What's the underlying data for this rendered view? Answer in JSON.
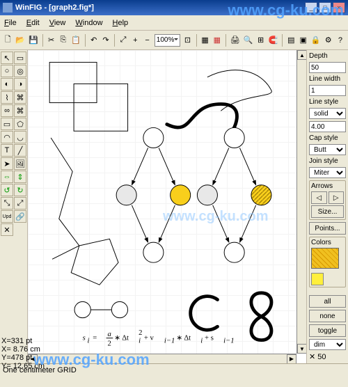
{
  "window": {
    "title": "WinFIG - [graph2.fig*]"
  },
  "menu": {
    "file": "File",
    "edit": "Edit",
    "view": "View",
    "window": "Window",
    "help": "Help"
  },
  "toolbar": {
    "zoom": "100%",
    "tooltip_new": "New",
    "tooltip_open": "Open",
    "tooltip_save": "Save"
  },
  "side": {
    "depth_label": "Depth",
    "depth": "50",
    "linewidth_label": "Line width",
    "linewidth": "1",
    "linestyle_label": "Line style",
    "linestyle": "solid",
    "dash_value": "4.00",
    "capstyle_label": "Cap style",
    "capstyle": "Butt",
    "joinstyle_label": "Join style",
    "joinstyle": "Miter",
    "arrows_label": "Arrows",
    "size_btn": "Size...",
    "points_btn": "Points...",
    "colors_label": "Colors",
    "all": "all",
    "none": "none",
    "toggle": "toggle",
    "dim": "dim",
    "depthflag": "50"
  },
  "coords": {
    "x": "X=331 pt",
    "xcm": "X= 8.76 cm",
    "y": "Y=478 pt",
    "ycm": "Y= 12.65 cm"
  },
  "status": {
    "grid": "One centimeter GRID"
  },
  "equation": "sᵢ = (a/2) * Δtᵢ² + vᵢ₋₁ * Δtᵢ + sᵢ₋₁",
  "watermark": "www.cg-ku.com"
}
